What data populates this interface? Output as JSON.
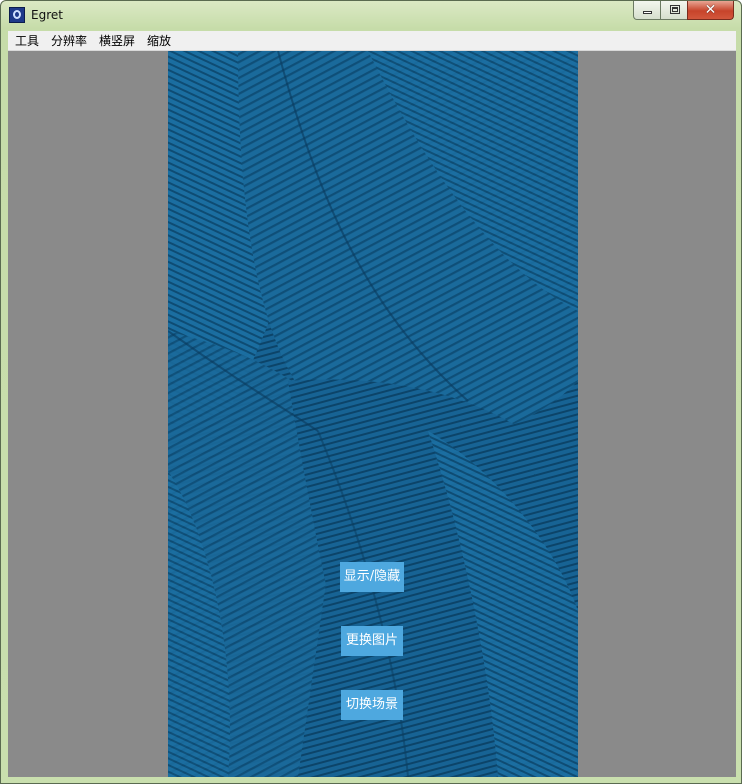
{
  "window": {
    "title": "Egret",
    "app_icon": "egret-app-icon",
    "controls": {
      "minimize_icon": "minimize-icon",
      "maximize_icon": "restore-icon",
      "close_icon": "close-icon",
      "close_glyph": "✕"
    }
  },
  "menu": {
    "items": [
      {
        "label": "工具"
      },
      {
        "label": "分辨率"
      },
      {
        "label": "横竖屏"
      },
      {
        "label": "缩放"
      }
    ]
  },
  "stage": {
    "background_color": "#15608f",
    "buttons": [
      {
        "label": "显示/隐藏"
      },
      {
        "label": "更换图片"
      },
      {
        "label": "切换场景"
      }
    ]
  },
  "colors": {
    "button_bg": "#4ea8df",
    "client_bg": "#8a8a8a",
    "close_button": "#c7442b"
  }
}
